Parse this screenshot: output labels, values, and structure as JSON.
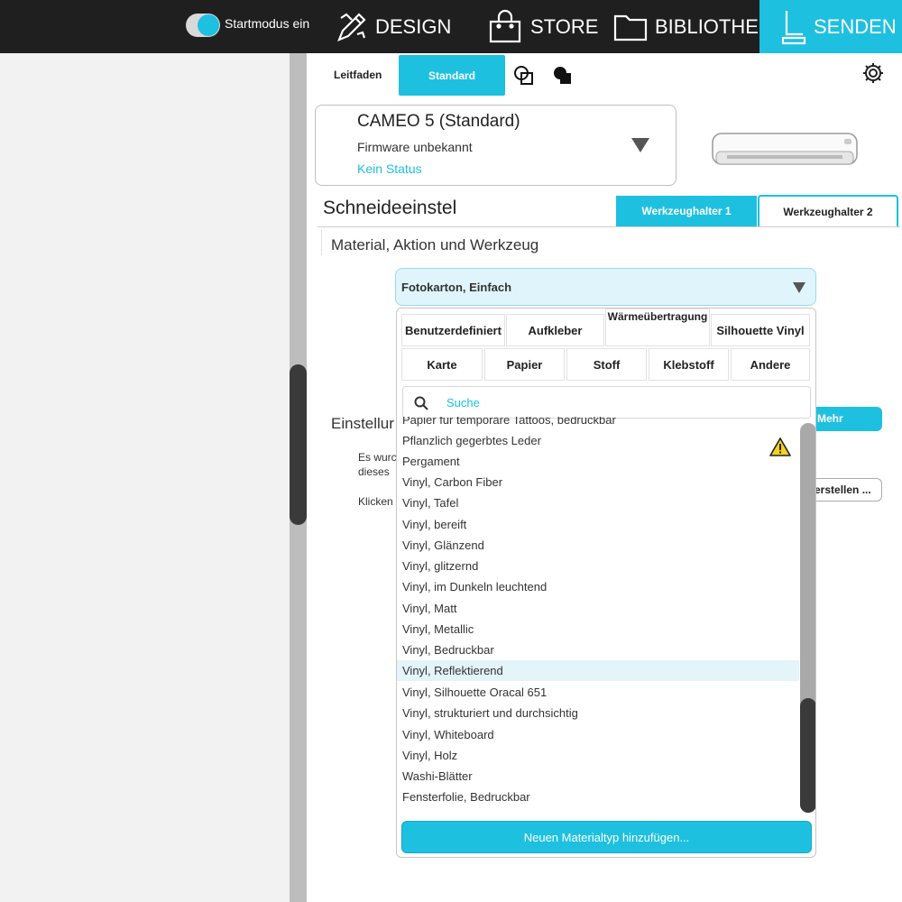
{
  "topbar": {
    "startmodus_label": "Startmodus ein",
    "nav": {
      "design": "DESIGN",
      "store": "STORE",
      "bibliothek": "BIBLIOTHEK",
      "senden": "SENDEN"
    }
  },
  "tabs": {
    "leitfaden": "Leitfaden",
    "standard": "Standard"
  },
  "machine": {
    "name": "CAMEO 5 (Standard)",
    "firmware": "Firmware unbekannt",
    "status": "Kein Status"
  },
  "cut": {
    "title": "Schneideeinstel",
    "tool_holder_1": "Werkzeughalter 1",
    "tool_holder_2": "Werkzeughalter 2",
    "material_section": "Material, Aktion und Werkzeug",
    "selected_material": "Fotokarton, Einfach"
  },
  "background": {
    "einstellung": "Einstellur",
    "es_line1": "Es wurc",
    "es_line2": "dieses",
    "klick": "Klicken",
    "mehr": "Mehr",
    "erstellen": "erstellen ..."
  },
  "dropdown": {
    "categories": [
      "Benutzerdefiniert",
      "Aufkleber",
      "Wärmeübertragung",
      "Silhouette Vinyl",
      "Karte",
      "Papier",
      "Stoff",
      "Klebstoff",
      "Andere"
    ],
    "search_placeholder": "Suche",
    "items": [
      "Papier für temporäre Tattoos, bedruckbar",
      "Pflanzlich gegerbtes Leder",
      "Pergament",
      "Vinyl, Carbon Fiber",
      "Vinyl, Tafel",
      "Vinyl, bereift",
      "Vinyl, Glänzend",
      "Vinyl, glitzernd",
      "Vinyl, im Dunkeln leuchtend",
      "Vinyl, Matt",
      "Vinyl, Metallic",
      "Vinyl, Bedruckbar",
      "Vinyl, Reflektierend",
      "Vinyl, Silhouette Oracal 651",
      "Vinyl, strukturiert und durchsichtig",
      "Vinyl, Whiteboard",
      "Vinyl, Holz",
      "Washi-Blätter",
      "Fensterfolie, Bedruckbar"
    ],
    "selected_item": "Vinyl, Reflektierend",
    "add_button": "Neuen Materialtyp hinzufügen..."
  },
  "colors": {
    "accent": "#1ec0e0",
    "topbar": "#1f1f1f",
    "warning": "#f5d21c"
  }
}
